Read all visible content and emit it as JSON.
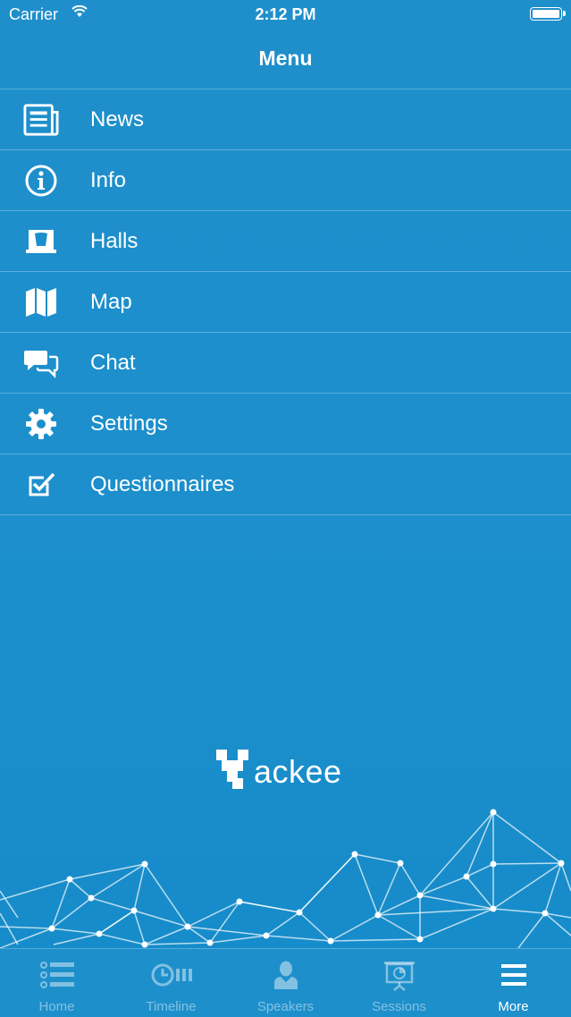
{
  "status_bar": {
    "carrier": "Carrier",
    "time": "2:12 PM"
  },
  "nav": {
    "title": "Menu"
  },
  "menu": {
    "items": [
      {
        "label": "News",
        "icon": "newspaper-icon"
      },
      {
        "label": "Info",
        "icon": "info-icon"
      },
      {
        "label": "Halls",
        "icon": "stage-icon"
      },
      {
        "label": "Map",
        "icon": "map-icon"
      },
      {
        "label": "Chat",
        "icon": "chat-icon"
      },
      {
        "label": "Settings",
        "icon": "gear-icon"
      },
      {
        "label": "Questionnaires",
        "icon": "checkbox-icon"
      }
    ]
  },
  "logo": {
    "text": "ackee"
  },
  "tab_bar": {
    "tabs": [
      {
        "label": "Home",
        "icon": "list-icon",
        "active": false
      },
      {
        "label": "Timeline",
        "icon": "timeline-icon",
        "active": false
      },
      {
        "label": "Speakers",
        "icon": "person-icon",
        "active": false
      },
      {
        "label": "Sessions",
        "icon": "presentation-icon",
        "active": false
      },
      {
        "label": "More",
        "icon": "hamburger-icon",
        "active": true
      }
    ]
  },
  "colors": {
    "background": "#1b8fcc",
    "text": "#ffffff",
    "inactive_tab": "#8cc7e6"
  }
}
